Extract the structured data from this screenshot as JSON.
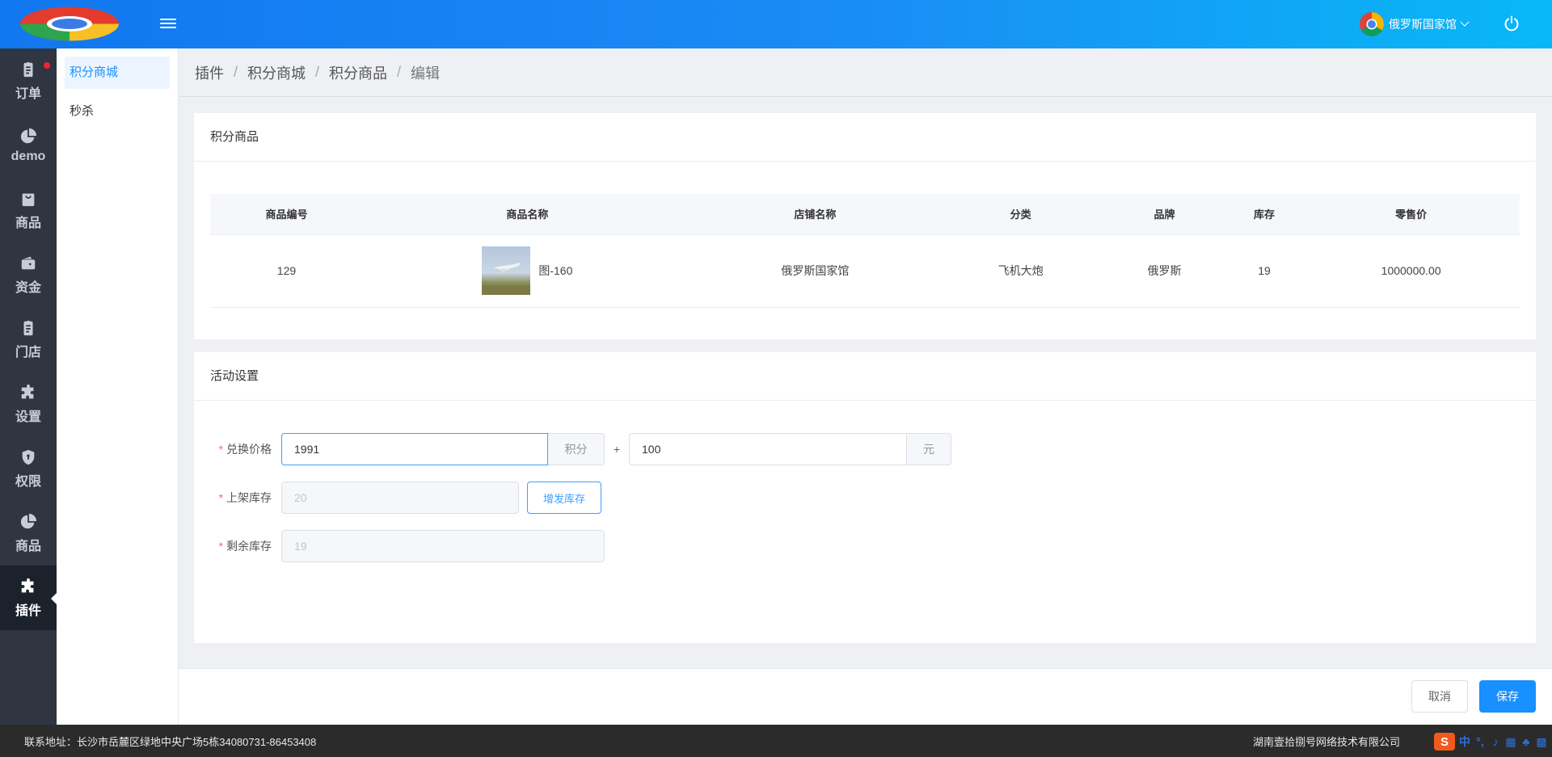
{
  "header": {
    "store_name": "俄罗斯国家馆"
  },
  "main_nav": [
    {
      "label": "订单",
      "icon": "clipboard-icon",
      "badge": true
    },
    {
      "label": "demo",
      "icon": "pie-chart-icon"
    },
    {
      "label": "商品",
      "icon": "shopping-bag-icon"
    },
    {
      "label": "资金",
      "icon": "wallet-icon"
    },
    {
      "label": "门店",
      "icon": "clipboard-icon"
    },
    {
      "label": "设置",
      "icon": "puzzle-icon"
    },
    {
      "label": "权限",
      "icon": "shield-icon"
    },
    {
      "label": "商品",
      "icon": "pie-chart-icon"
    },
    {
      "label": "插件",
      "icon": "puzzle-icon",
      "active": true
    }
  ],
  "sub_nav": [
    {
      "label": "积分商城",
      "active": true
    },
    {
      "label": "秒杀"
    }
  ],
  "breadcrumb": [
    "插件",
    "积分商城",
    "积分商品",
    "编辑"
  ],
  "goods_card": {
    "title": "积分商品",
    "columns": [
      "商品编号",
      "商品名称",
      "店铺名称",
      "分类",
      "品牌",
      "库存",
      "零售价"
    ],
    "rows": [
      {
        "id": "129",
        "name": "图-160",
        "shop": "俄罗斯国家馆",
        "category": "飞机大炮",
        "brand": "俄罗斯",
        "stock": "19",
        "price": "1000000.00"
      }
    ]
  },
  "activity_card": {
    "title": "活动设置",
    "exchange_price": {
      "label": "兑换价格",
      "points": "1991",
      "points_unit": "积分",
      "plus": "+",
      "cash": "100",
      "cash_unit": "元"
    },
    "listed_stock": {
      "label": "上架库存",
      "value": "20",
      "add_button": "增发库存"
    },
    "remaining_stock": {
      "label": "剩余库存",
      "value": "19"
    }
  },
  "actions": {
    "cancel": "取消",
    "save": "保存"
  },
  "footer": {
    "address": "联系地址：长沙市岳麓区绿地中央广场5栋34080731-86453408",
    "company": "湖南壹拾捌号网络技术有限公司"
  },
  "colors": {
    "primary": "#1890ff",
    "nav_bg": "#2f3541",
    "header_start": "#1177f0",
    "header_end": "#08b8f6"
  }
}
